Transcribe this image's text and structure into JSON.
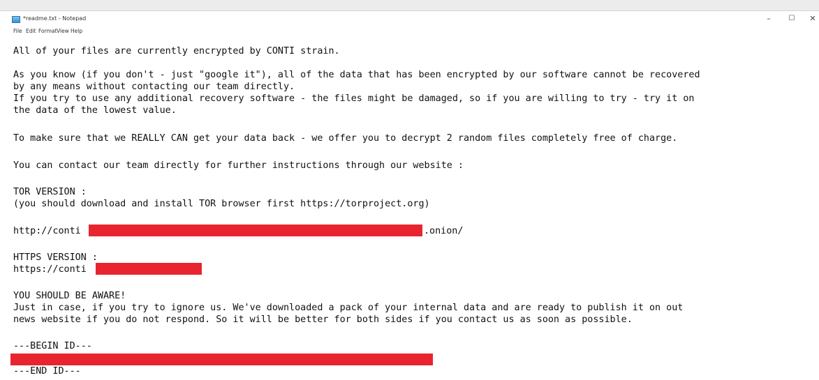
{
  "window": {
    "title": "*readme.txt - Notepad",
    "minimize_glyph": "–",
    "maximize_glyph": "☐",
    "close_glyph": "✕"
  },
  "menu": {
    "items": [
      "File",
      "Edit",
      "Format",
      "View",
      "Help"
    ]
  },
  "document": {
    "lines": [
      "All of your files are currently encrypted by CONTI strain.",
      "As you know (if you don't - just \"google it\"), all of the data that has been encrypted by our software cannot be recovered",
      "by any means without contacting our team directly.",
      "If you try to use any additional recovery software - the files might be damaged, so if you are willing to try - try it on",
      "the data of the lowest value.",
      "To make sure that we REALLY CAN get your data back - we offer you to decrypt 2 random files completely free of charge.",
      "You can contact our team directly for further instructions through our website :",
      "TOR VERSION :",
      "(you should download and install TOR browser first https://torproject.org)",
      "http://conti",
      ".onion/",
      "HTTPS VERSION :",
      "https://conti",
      "YOU SHOULD BE AWARE!",
      "Just in case, if you try to ignore us. We've downloaded a pack of your internal data and are ready to publish it on out",
      "news website if you do not respond. So it will be better for both sides if you contact us as soon as possible.",
      "---BEGIN ID---",
      "---END ID---"
    ]
  },
  "colors": {
    "redaction": "#e8242f",
    "text": "#111111",
    "background": "#ffffff"
  }
}
